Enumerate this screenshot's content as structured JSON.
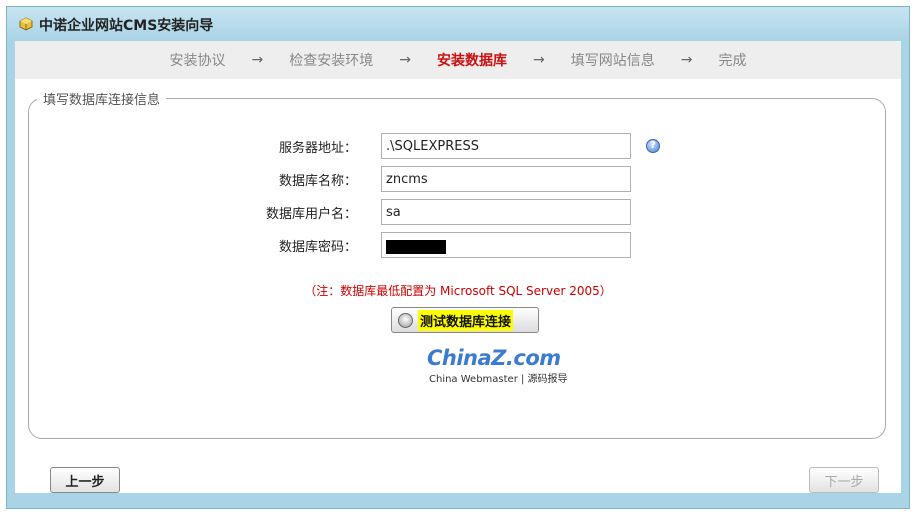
{
  "window": {
    "title": "中诺企业网站CMS安装向导"
  },
  "steps": [
    {
      "label": "安装协议"
    },
    {
      "label": "检查安装环境"
    },
    {
      "label": "安装数据库",
      "active": true
    },
    {
      "label": "填写网站信息"
    },
    {
      "label": "完成"
    }
  ],
  "arrow": "→",
  "form": {
    "legend": "填写数据库连接信息",
    "server_label": "服务器地址：",
    "server_value": ".\\SQLEXPRESS",
    "dbname_label": "数据库名称：",
    "dbname_value": "zncms",
    "user_label": "数据库用户名：",
    "user_value": "sa",
    "password_label": "数据库密码：",
    "help_icon": "?"
  },
  "note": "（注：数据库最低配置为 Microsoft SQL Server 2005）",
  "test_button": {
    "label": "测试数据库连接"
  },
  "logo": {
    "main": "ChinaZ.com",
    "sub": "China Webmaster | 源码报导"
  },
  "nav": {
    "prev_label": "上一步",
    "next_label": "下一步"
  },
  "colors": {
    "active_step": "#cc1111",
    "note": "#cc0000",
    "frame": "#a9d4e6",
    "highlight": "#ffff00"
  }
}
